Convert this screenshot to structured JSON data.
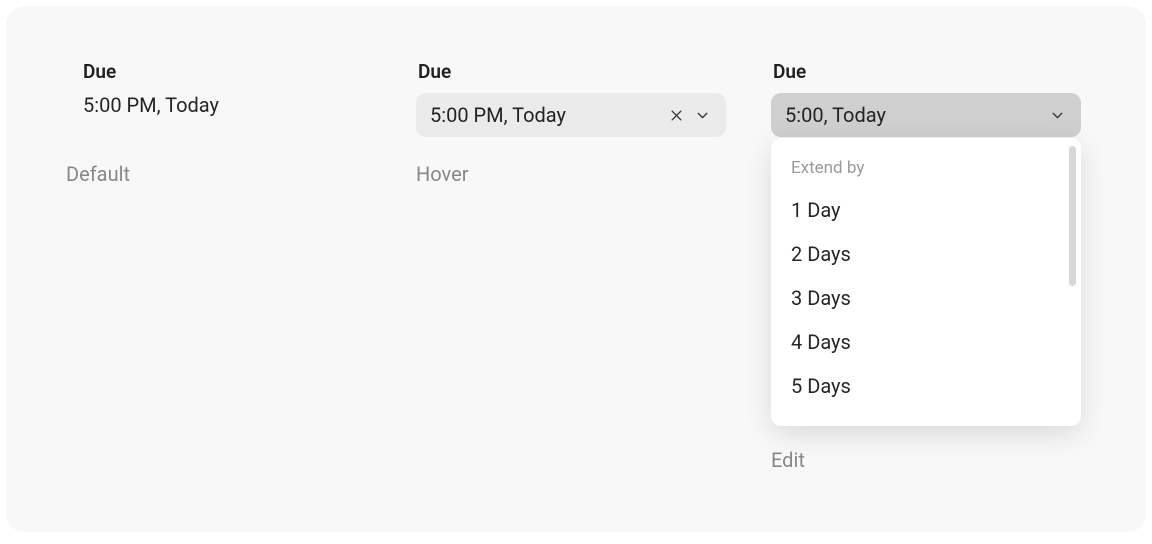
{
  "default": {
    "label": "Due",
    "value": "5:00 PM, Today",
    "state_caption": "Default"
  },
  "hover": {
    "label": "Due",
    "value": "5:00 PM, Today",
    "state_caption": "Hover"
  },
  "edit": {
    "label": "Due",
    "value": "5:00, Today",
    "state_caption": "Edit",
    "menu_heading": "Extend by",
    "menu_items": [
      "1 Day",
      "2 Days",
      "3 Days",
      "4 Days",
      "5 Days"
    ]
  }
}
